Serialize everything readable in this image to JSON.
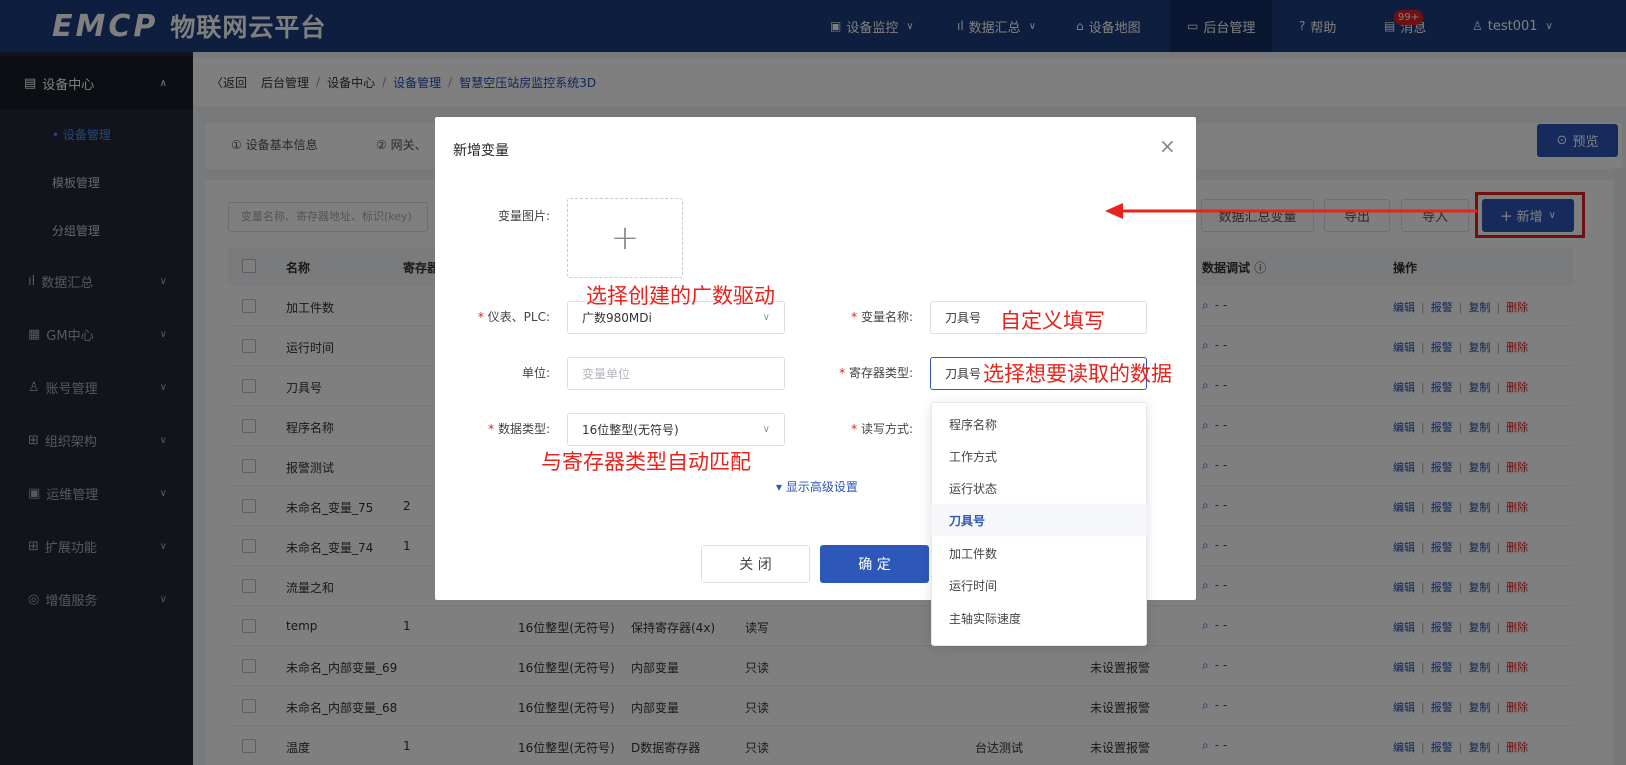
{
  "header": {
    "brand": "EMCP",
    "subtitle": "物联网云平台",
    "nav": [
      {
        "label": "设备监控",
        "icon": "monitor-icon",
        "dropdown": true
      },
      {
        "label": "数据汇总",
        "icon": "chart-icon",
        "dropdown": true
      },
      {
        "label": "设备地图",
        "icon": "map-icon",
        "dropdown": false
      },
      {
        "label": "后台管理",
        "icon": "admin-icon",
        "dropdown": false,
        "active": true
      },
      {
        "label": "帮助",
        "icon": "help-icon",
        "dropdown": false
      },
      {
        "label": "消息",
        "icon": "message-icon",
        "dropdown": false
      },
      {
        "label": "test001",
        "icon": "user-icon",
        "dropdown": true
      }
    ],
    "message_badge": "99+"
  },
  "sidebar": {
    "section": "设备中心",
    "subitems": [
      "• 设备管理",
      "模板管理",
      "分组管理"
    ],
    "items": [
      "数据汇总",
      "GM中心",
      "账号管理",
      "组织架构",
      "运维管理",
      "扩展功能",
      "增值服务"
    ]
  },
  "breadcrumb": {
    "back": "〈返回",
    "items": [
      "后台管理",
      "设备中心",
      "设备管理",
      "智慧空压站房监控系统3D"
    ]
  },
  "steps": {
    "step1": "① 设备基本信息",
    "step2": "② 网关、"
  },
  "toolbar": {
    "preview": "预览",
    "search_placeholder": "变量名称、寄存器地址、标识(key)",
    "summary_btn": "数据汇总变量",
    "export_btn": "导出",
    "import_btn": "导入",
    "add_btn": "新增"
  },
  "table": {
    "headers": {
      "name": "名称",
      "register": "寄存器",
      "debug": "数据调试",
      "ops": "操作"
    },
    "rows": [
      {
        "name": "加工件数",
        "c1": "",
        "c2": "",
        "c3": "",
        "c4": "",
        "c5": "",
        "c6": ""
      },
      {
        "name": "运行时间",
        "c1": "",
        "c2": "",
        "c3": "",
        "c4": "",
        "c5": "",
        "c6": ""
      },
      {
        "name": "刀具号",
        "c1": "",
        "c2": "",
        "c3": "",
        "c4": "",
        "c5": "",
        "c6": ""
      },
      {
        "name": "程序名称",
        "c1": "",
        "c2": "",
        "c3": "",
        "c4": "",
        "c5": "",
        "c6": ""
      },
      {
        "name": "报警测试",
        "c1": "",
        "c2": "",
        "c3": "",
        "c4": "",
        "c5": "",
        "c6": ""
      },
      {
        "name": "未命名_变量_75",
        "c1": "2",
        "c2": "",
        "c3": "",
        "c4": "",
        "c5": "",
        "c6": ""
      },
      {
        "name": "未命名_变量_74",
        "c1": "1",
        "c2": "",
        "c3": "",
        "c4": "",
        "c5": "",
        "c6": ""
      },
      {
        "name": "流量之和",
        "c1": "",
        "c2": "",
        "c3": "",
        "c4": "",
        "c5": "",
        "c6": ""
      },
      {
        "name": "temp",
        "c1": "1",
        "c2": "16位整型(无符号)",
        "c3": "保持寄存器(4x)",
        "c4": "读写",
        "c5": "",
        "c6": ""
      },
      {
        "name": "未命名_内部变量_69",
        "c1": "",
        "c2": "16位整型(无符号)",
        "c3": "内部变量",
        "c4": "只读",
        "c5": "",
        "c6": "未设置报警"
      },
      {
        "name": "未命名_内部变量_68",
        "c1": "",
        "c2": "16位整型(无符号)",
        "c3": "内部变量",
        "c4": "只读",
        "c5": "",
        "c6": "未设置报警"
      },
      {
        "name": "温度",
        "c1": "1",
        "c2": "16位整型(无符号)",
        "c3": "D数据寄存器",
        "c4": "只读",
        "c5": "台达测试",
        "c6": "未设置报警"
      }
    ],
    "debug_text": "- -",
    "ops": {
      "edit": "编辑",
      "alarm": "报警",
      "copy": "复制",
      "delete": "删除"
    }
  },
  "dialog": {
    "title": "新增变量",
    "close": "×",
    "image_label": "变量图片:",
    "plc_label": "仪表、PLC:",
    "plc_value": "广数980MDi",
    "name_label": "变量名称:",
    "name_value": "刀具号",
    "unit_label": "单位:",
    "unit_placeholder": "变量单位",
    "register_label": "寄存器类型:",
    "register_value": "刀具号",
    "datatype_label": "数据类型:",
    "datatype_value": "16位整型(无符号)",
    "rw_label": "读写方式:",
    "advanced": "▾ 显示高级设置",
    "close_btn": "关 闭",
    "ok_btn": "确 定",
    "dropdown": [
      "程序名称",
      "工作方式",
      "运行状态",
      "刀具号",
      "加工件数",
      "运行时间",
      "主轴实际速度"
    ],
    "dropdown_selected": "刀具号"
  },
  "annotations": {
    "a1": "选择创建的广数驱动",
    "a2": "自定义填写",
    "a3": "选择想要读取的数据",
    "a4": "与寄存器类型自动匹配"
  },
  "colors": {
    "header": "#1c3c7c",
    "primary": "#2d57b8",
    "annotation": "#e8231d",
    "sidebar": "#222a36"
  }
}
